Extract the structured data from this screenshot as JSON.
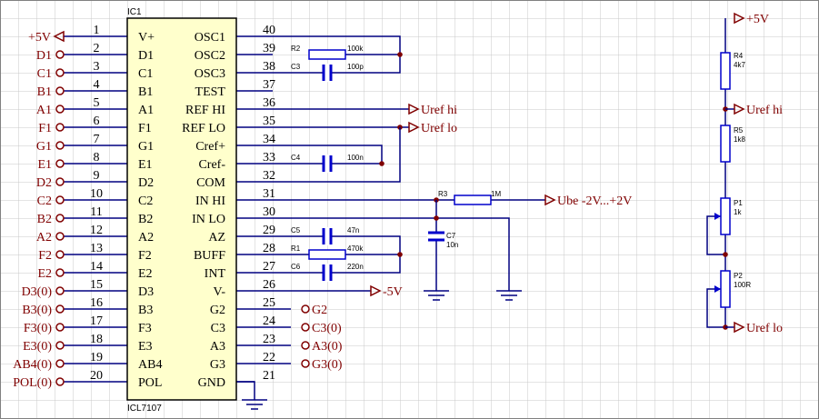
{
  "colors": {
    "background": "#ffffff",
    "grid": "#c8c8c8",
    "border": "#808080",
    "wire": "#000080",
    "component": "#0000cc",
    "net_label": "#800000",
    "pin_text": "#000000",
    "ic_fill": "#ffffcc"
  },
  "ic": {
    "designator": "IC1",
    "part": "ICL7107",
    "left_pins": [
      {
        "num": "1",
        "name": "V+",
        "net": "+5V"
      },
      {
        "num": "2",
        "name": "D1",
        "net": "D1"
      },
      {
        "num": "3",
        "name": "C1",
        "net": "C1"
      },
      {
        "num": "4",
        "name": "B1",
        "net": "B1"
      },
      {
        "num": "5",
        "name": "A1",
        "net": "A1"
      },
      {
        "num": "6",
        "name": "F1",
        "net": "F1"
      },
      {
        "num": "7",
        "name": "G1",
        "net": "G1"
      },
      {
        "num": "8",
        "name": "E1",
        "net": "E1"
      },
      {
        "num": "9",
        "name": "D2",
        "net": "D2"
      },
      {
        "num": "10",
        "name": "C2",
        "net": "C2"
      },
      {
        "num": "11",
        "name": "B2",
        "net": "B2"
      },
      {
        "num": "12",
        "name": "A2",
        "net": "A2"
      },
      {
        "num": "13",
        "name": "F2",
        "net": "F2"
      },
      {
        "num": "14",
        "name": "E2",
        "net": "E2"
      },
      {
        "num": "15",
        "name": "D3",
        "net": "D3(0)"
      },
      {
        "num": "16",
        "name": "B3",
        "net": "B3(0)"
      },
      {
        "num": "17",
        "name": "F3",
        "net": "F3(0)"
      },
      {
        "num": "18",
        "name": "E3",
        "net": "E3(0)"
      },
      {
        "num": "19",
        "name": "AB4",
        "net": "AB4(0)"
      },
      {
        "num": "20",
        "name": "POL",
        "net": "POL(0)"
      }
    ],
    "right_pins": [
      {
        "num": "40",
        "name": "OSC1",
        "net": ""
      },
      {
        "num": "39",
        "name": "OSC2",
        "net": ""
      },
      {
        "num": "38",
        "name": "OSC3",
        "net": ""
      },
      {
        "num": "37",
        "name": "TEST",
        "net": ""
      },
      {
        "num": "36",
        "name": "REF HI",
        "net": ""
      },
      {
        "num": "35",
        "name": "REF LO",
        "net": ""
      },
      {
        "num": "34",
        "name": "Cref+",
        "net": ""
      },
      {
        "num": "33",
        "name": "Cref-",
        "net": ""
      },
      {
        "num": "32",
        "name": "COM",
        "net": ""
      },
      {
        "num": "31",
        "name": "IN HI",
        "net": ""
      },
      {
        "num": "30",
        "name": "IN LO",
        "net": ""
      },
      {
        "num": "29",
        "name": "AZ",
        "net": ""
      },
      {
        "num": "28",
        "name": "BUFF",
        "net": ""
      },
      {
        "num": "27",
        "name": "INT",
        "net": ""
      },
      {
        "num": "26",
        "name": "V-",
        "net": ""
      },
      {
        "num": "25",
        "name": "G2",
        "net": "G2"
      },
      {
        "num": "24",
        "name": "C3",
        "net": "C3(0)"
      },
      {
        "num": "23",
        "name": "A3",
        "net": "A3(0)"
      },
      {
        "num": "22",
        "name": "G3",
        "net": "G3(0)"
      },
      {
        "num": "21",
        "name": "GND",
        "net": ""
      }
    ]
  },
  "components": {
    "r2": {
      "ref": "R2",
      "value": "100k"
    },
    "c3": {
      "ref": "C3",
      "value": "100p"
    },
    "c4": {
      "ref": "C4",
      "value": "100n"
    },
    "r3": {
      "ref": "R3",
      "value": "1M"
    },
    "c5": {
      "ref": "C5",
      "value": "47n"
    },
    "r1": {
      "ref": "R1",
      "value": "470k"
    },
    "c6": {
      "ref": "C6",
      "value": "220n"
    },
    "c7": {
      "ref": "C7",
      "value": "10n"
    },
    "r4": {
      "ref": "R4",
      "value": "4k7"
    },
    "r5": {
      "ref": "R5",
      "value": "1k8"
    },
    "p1": {
      "ref": "P1",
      "value": "1k"
    },
    "p2": {
      "ref": "P2",
      "value": "100R"
    }
  },
  "ports": {
    "uref_hi": "Uref hi",
    "uref_lo": "Uref lo",
    "ube": "Ube -2V...+2V",
    "neg5v": "-5V",
    "pos5v_right": "+5V",
    "uref_hi_right": "Uref hi",
    "uref_lo_right": "Uref lo"
  }
}
